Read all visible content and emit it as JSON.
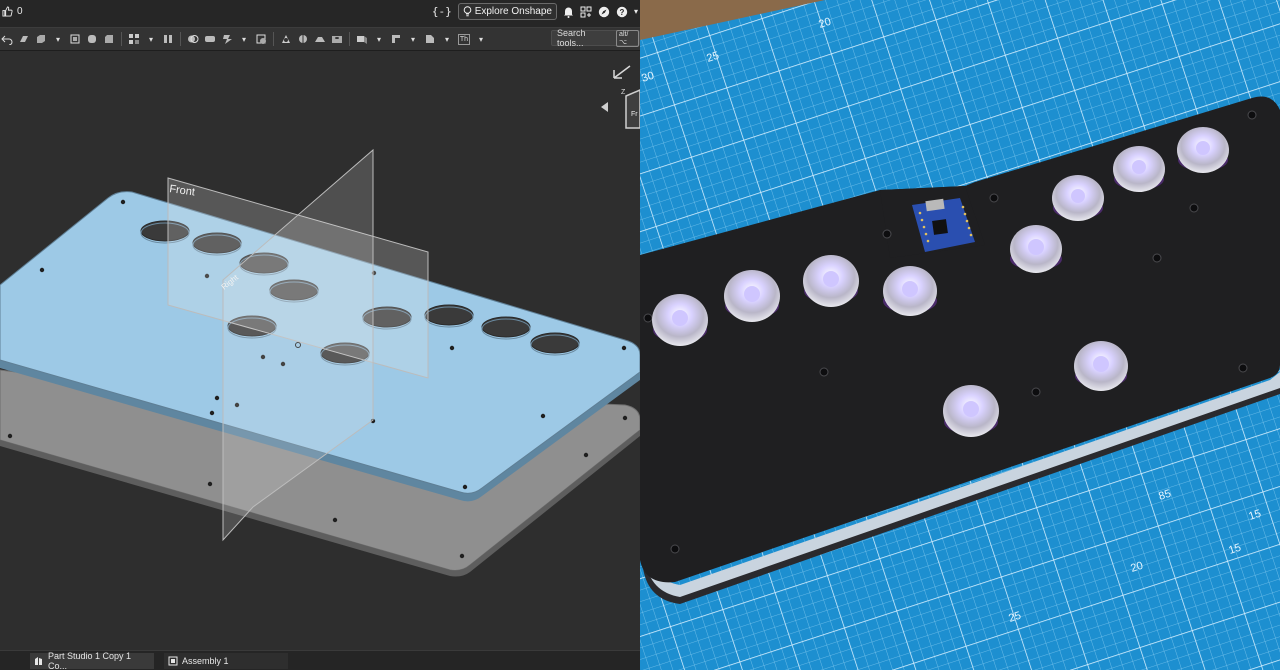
{
  "app": {
    "like_count": "0",
    "code_icon_label": "{-}",
    "explore_label": "Explore Onshape",
    "search_placeholder": "Search tools...",
    "search_shortcut": "alt/⌥",
    "text_tool_label": "Th"
  },
  "viewport": {
    "plane_front_label": "Front",
    "plane_right_label": "Right",
    "view_cube_label": "Fr",
    "axis_label": "Z"
  },
  "tabs": [
    {
      "label": "Part Studio 1 Copy 1 Co..."
    },
    {
      "label": "Assembly 1"
    }
  ],
  "photo": {
    "mat_numbers": [
      "20",
      "25",
      "30",
      "15",
      "85",
      "20",
      "25",
      "15"
    ]
  },
  "colors": {
    "plate_blue": "#9dc9e6",
    "plate_gray": "#8f8f8f",
    "cad_background": "#2e2e2e",
    "mat_blue": "#1d8fd0",
    "device_black": "#1f1f21"
  }
}
